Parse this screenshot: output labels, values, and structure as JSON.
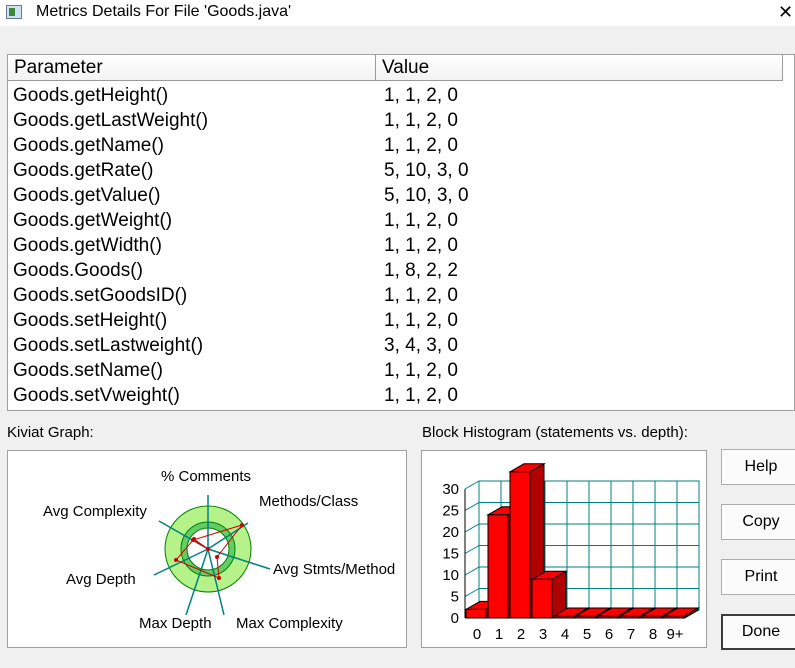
{
  "window": {
    "title": "Metrics Details For File 'Goods.java'",
    "close_glyph": "✕"
  },
  "table": {
    "headers": [
      "Parameter",
      "Value"
    ],
    "rows": [
      {
        "param": "Goods.getHeight()",
        "value": "1, 1, 2, 0"
      },
      {
        "param": "Goods.getLastWeight()",
        "value": "1, 1, 2, 0"
      },
      {
        "param": "Goods.getName()",
        "value": "1, 1, 2, 0"
      },
      {
        "param": "Goods.getRate()",
        "value": "5, 10, 3, 0"
      },
      {
        "param": "Goods.getValue()",
        "value": "5, 10, 3, 0"
      },
      {
        "param": "Goods.getWeight()",
        "value": "1, 1, 2, 0"
      },
      {
        "param": "Goods.getWidth()",
        "value": "1, 1, 2, 0"
      },
      {
        "param": "Goods.Goods()",
        "value": "1, 8, 2, 2"
      },
      {
        "param": "Goods.setGoodsID()",
        "value": "1, 1, 2, 0"
      },
      {
        "param": "Goods.setHeight()",
        "value": "1, 1, 2, 0"
      },
      {
        "param": "Goods.setLastweight()",
        "value": "3, 4, 3, 0"
      },
      {
        "param": "Goods.setName()",
        "value": "1, 1, 2, 0"
      },
      {
        "param": "Goods.setVweight()",
        "value": "1, 1, 2, 0"
      }
    ]
  },
  "kiviat": {
    "label": "Kiviat Graph:",
    "axes": [
      "% Comments",
      "Methods/Class",
      "Avg Stmts/Method",
      "Max Complexity",
      "Max Depth",
      "Avg Depth",
      "Avg Complexity"
    ],
    "colors": {
      "outer_ring": "#b6f28a",
      "inner_ring": "#66cc66",
      "center": "#ffffff",
      "spokes": "#008080",
      "polygon": "#cc0000"
    }
  },
  "histogram": {
    "label": "Block Histogram (statements vs. depth):",
    "colors": {
      "bar": "#ff0000",
      "bar_side": "#b00000",
      "grid": "#008080"
    }
  },
  "chart_data": {
    "type": "bar",
    "title": "Block Histogram (statements vs. depth):",
    "categories": [
      "0",
      "1",
      "2",
      "3",
      "4",
      "5",
      "6",
      "7",
      "8",
      "9+"
    ],
    "values": [
      2,
      24,
      34,
      9,
      0,
      0,
      0,
      0,
      0,
      0
    ],
    "y_ticks": [
      0,
      5,
      10,
      15,
      20,
      25,
      30
    ],
    "ylim": [
      0,
      30
    ],
    "grid": true
  },
  "buttons": {
    "help": "Help",
    "copy": "Copy",
    "print": "Print",
    "done": "Done"
  }
}
